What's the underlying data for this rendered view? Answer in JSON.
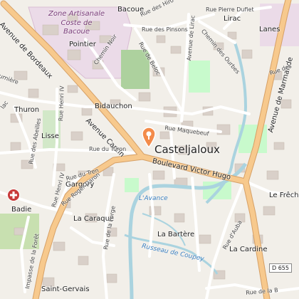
{
  "map": {
    "colors": {
      "background": "#f2efe9",
      "building": "#d9d0c9",
      "road_major": "#f7c98d",
      "road_major_casing": "#d6a066",
      "road_minor": "#ffffff",
      "water": "#aad3df",
      "park": "#c8facc",
      "forest": "#add19e",
      "industrial": "#ebdbe8",
      "marker": "#f38b4a"
    },
    "town_label": "Casteljaloux",
    "zone_label_line1": "Zone Artisanale",
    "zone_label_line2": "Coste de",
    "zone_label_line3": "Bacoue",
    "places": {
      "bacoue": "Bacoue",
      "pointier": "Pointier",
      "lirac": "Lirac",
      "lanes": "Lanes",
      "bidauchon": "Bidauchon",
      "thuron": "Thuron",
      "lisse": "Lisse",
      "gargory": "Gargory",
      "badie": "Badie",
      "la_caraque": "La Caraque",
      "la_bartere": "La Bartère",
      "la_cardine": "La Cardine",
      "le_freche": "Le Frêche",
      "saint_gervais": "Saint-Gervais"
    },
    "streets": {
      "avenue_de_bordeaux": "Avenue de Bordeaux",
      "avenue_carcin": "Avenue Carcin",
      "boulevard_victor_hugo": "Boulevard Victor Hugo",
      "avenue_de_marmande": "Avenue de Marmande",
      "rue_pierre_dufiet": "Rue Pierre Dufiet",
      "rue_des_pinsons": "Rue des Pinsons",
      "rue_de_beloc": "Rue de Beloc",
      "avenue_de_lirac": "Avenue de Lirac",
      "chemin_des_ourbes": "Chemin des Ourbes",
      "chemin_noir": "Chemin Noir",
      "rue_maquebeuf": "Rue Maquebeuf",
      "rue_du_turon": "Rue du Turon",
      "rue_henri_iv_a": "Rue Henri IV",
      "rue_henri_iv_b": "Rue Henri IV",
      "rue_des_abeilles": "Rue des Abeilles",
      "rue_du_tren": "Rue du Tren",
      "rue_roger_daron": "Rue Roger Daron",
      "rue_de_la_forge": "Rue de la Forge",
      "impasse_de_la_foret": "Impasse de la Forêt",
      "rue_d_auba": "Rue d'Auba",
      "rue_des_hirondelles": "Rue des Hiro",
      "rue_des": "Rue des",
      "lac": "lac",
      "urniere": "urnière",
      "rue_de_la_b": "Rue de la B"
    },
    "water": {
      "avance": "L'Avance",
      "russeau_de_coupey": "Russeau de Coupey"
    },
    "road_ref": "D 655"
  }
}
